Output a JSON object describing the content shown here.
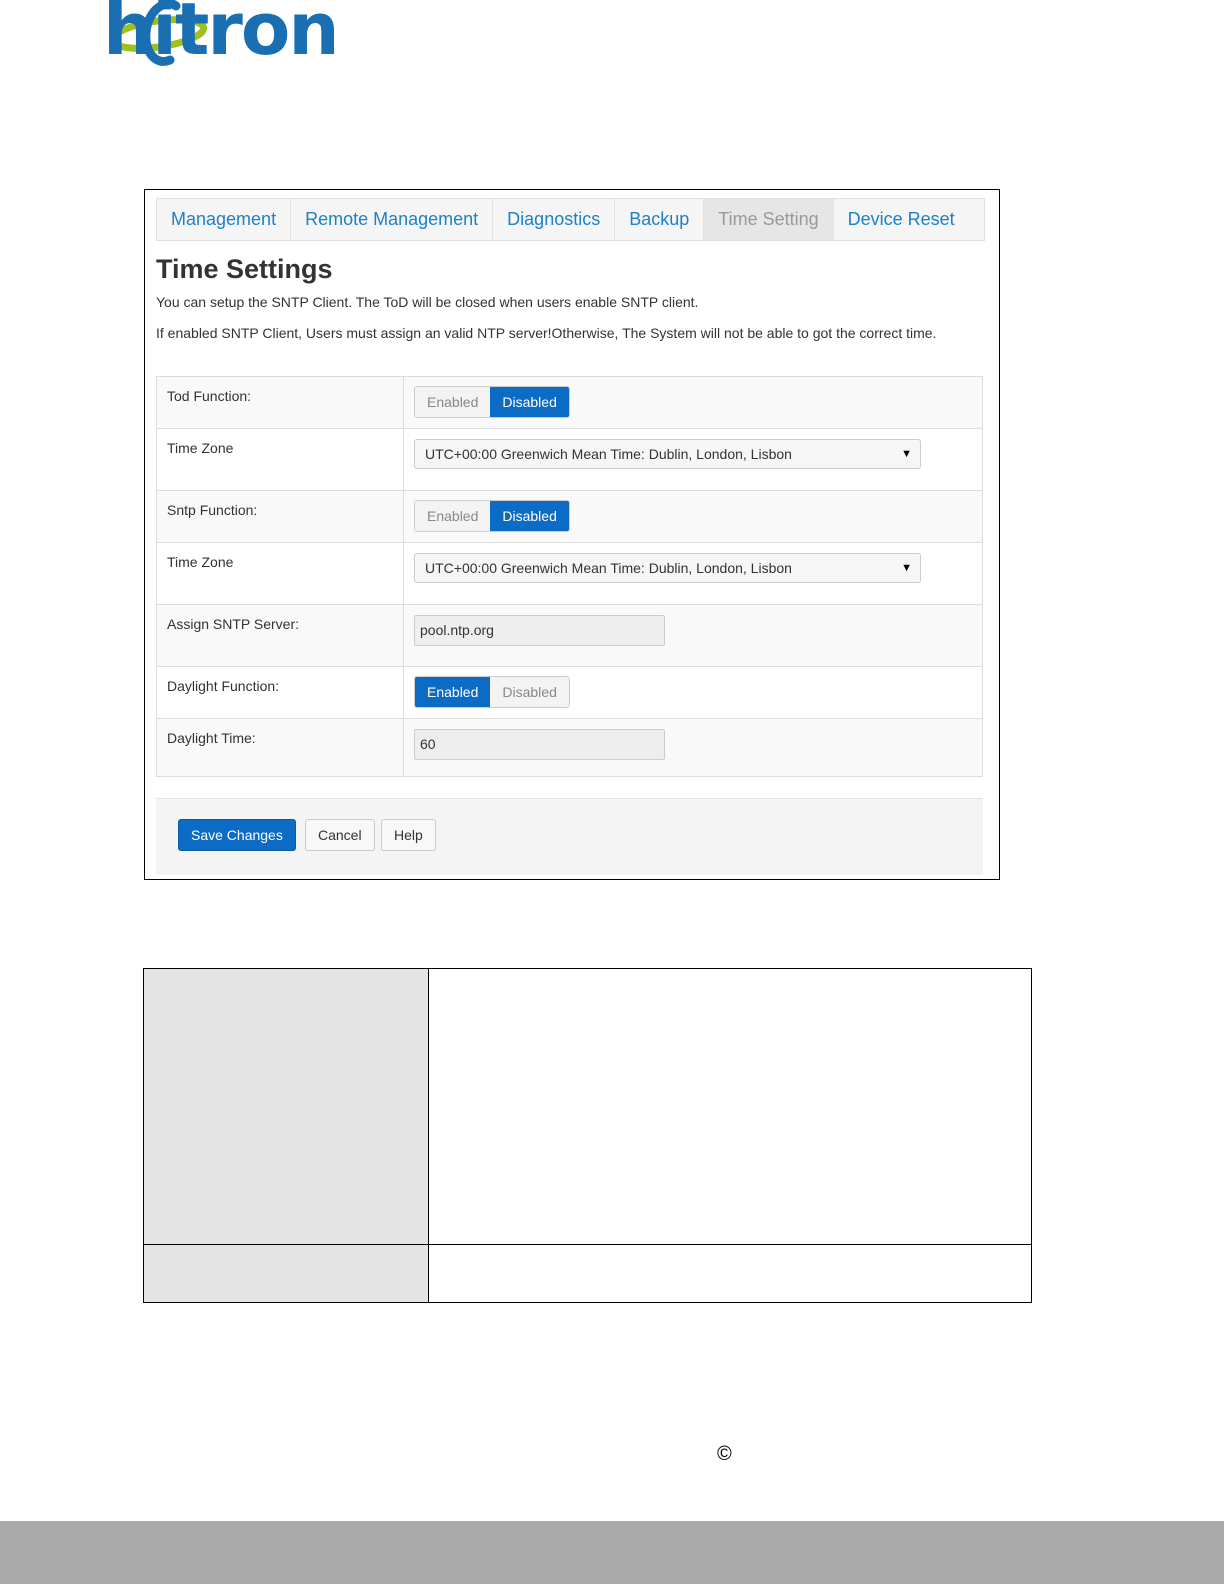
{
  "logo": {
    "text": "hitron"
  },
  "tabs": [
    {
      "label": "Management"
    },
    {
      "label": "Remote Management"
    },
    {
      "label": "Diagnostics"
    },
    {
      "label": "Backup"
    },
    {
      "label": "Time Setting",
      "active": true
    },
    {
      "label": "Device Reset"
    }
  ],
  "page": {
    "title": "Time Settings",
    "desc1": "You can setup the SNTP Client. The ToD will be closed when users enable SNTP client.",
    "desc2": "If enabled SNTP Client, Users must assign an valid NTP server!Otherwise, The System will not be able to got the correct time."
  },
  "form": {
    "tod_function": {
      "label": "Tod Function:",
      "enabled": "Enabled",
      "disabled": "Disabled",
      "selected": "Disabled"
    },
    "time_zone_1": {
      "label": "Time Zone",
      "value": "UTC+00:00 Greenwich Mean Time: Dublin, London, Lisbon"
    },
    "sntp_function": {
      "label": "Sntp Function:",
      "enabled": "Enabled",
      "disabled": "Disabled",
      "selected": "Disabled"
    },
    "time_zone_2": {
      "label": "Time Zone",
      "value": "UTC+00:00 Greenwich Mean Time: Dublin, London, Lisbon"
    },
    "sntp_server": {
      "label": "Assign SNTP Server:",
      "value": "pool.ntp.org"
    },
    "daylight_function": {
      "label": "Daylight Function:",
      "enabled": "Enabled",
      "disabled": "Disabled",
      "selected": "Enabled"
    },
    "daylight_time": {
      "label": "Daylight Time:",
      "value": "60"
    }
  },
  "actions": {
    "save": "Save Changes",
    "cancel": "Cancel",
    "help": "Help"
  },
  "footer": {
    "copyright_symbol": "©"
  },
  "colors": {
    "accent": "#0c6bc4",
    "tab_link": "#1b82c8",
    "logo_blue": "#1a6fb3",
    "logo_green": "#9bc31c"
  }
}
